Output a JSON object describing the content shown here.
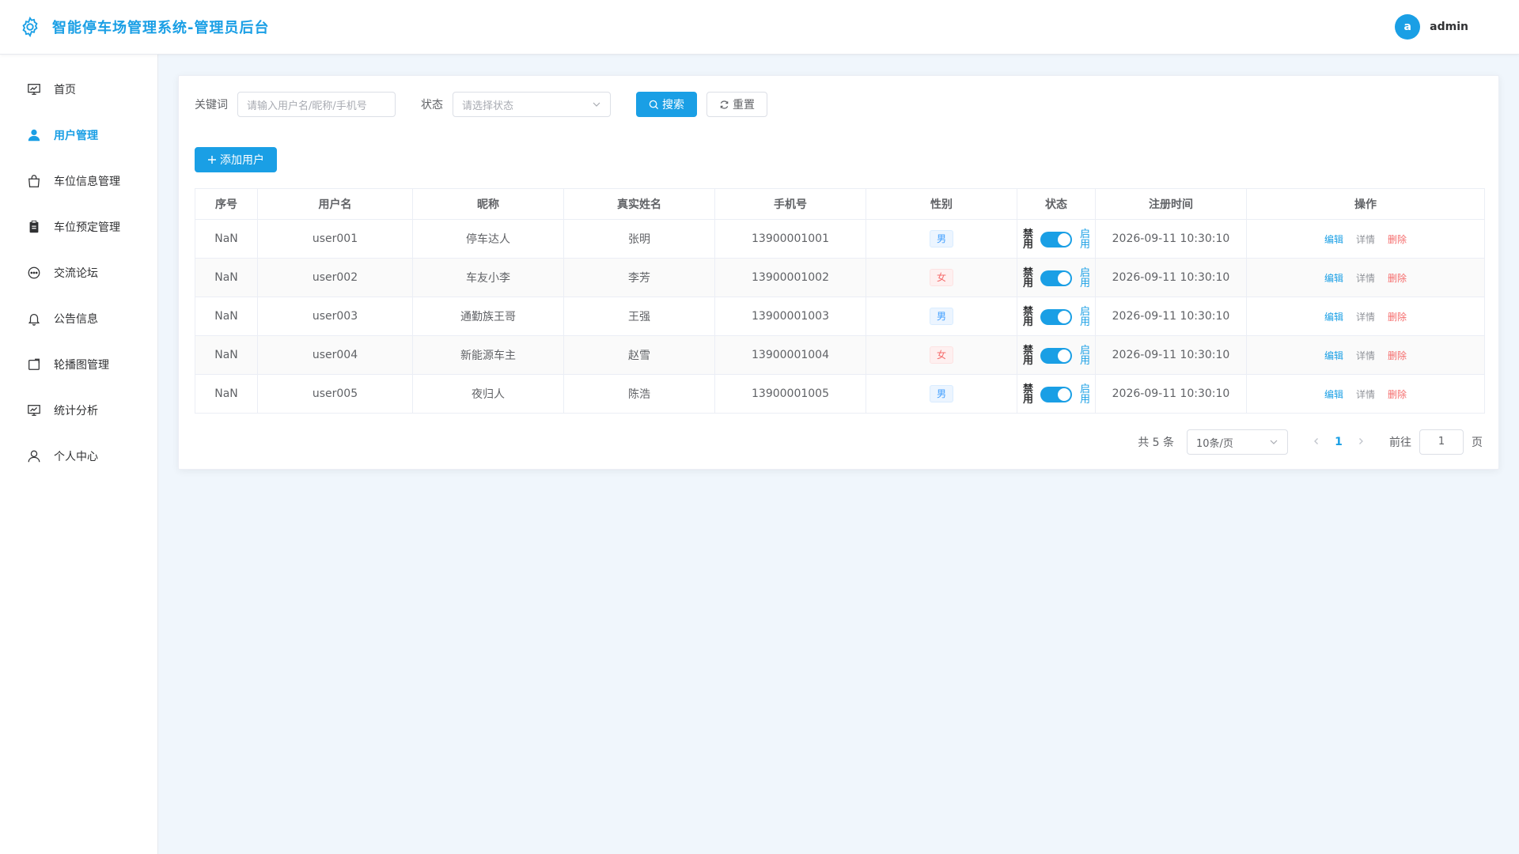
{
  "header": {
    "title": "智能停车场管理系统-管理员后台",
    "avatar_letter": "a",
    "username": "admin"
  },
  "sidebar": {
    "items": [
      {
        "label": "首页",
        "icon": "dashboard-icon"
      },
      {
        "label": "用户管理",
        "icon": "user-icon",
        "active": true
      },
      {
        "label": "车位信息管理",
        "icon": "bag-icon"
      },
      {
        "label": "车位预定管理",
        "icon": "clipboard-icon"
      },
      {
        "label": "交流论坛",
        "icon": "chat-icon"
      },
      {
        "label": "公告信息",
        "icon": "bell-icon"
      },
      {
        "label": "轮播图管理",
        "icon": "image-icon"
      },
      {
        "label": "统计分析",
        "icon": "chart-icon"
      },
      {
        "label": "个人中心",
        "icon": "person-icon"
      }
    ]
  },
  "filters": {
    "keyword_label": "关键词",
    "keyword_placeholder": "请输入用户名/昵称/手机号",
    "status_label": "状态",
    "status_placeholder": "请选择状态",
    "search_label": "搜索",
    "reset_label": "重置"
  },
  "add_button_label": "添加用户",
  "table": {
    "columns": [
      "序号",
      "用户名",
      "昵称",
      "真实姓名",
      "手机号",
      "性别",
      "状态",
      "注册时间",
      "操作"
    ],
    "switch_off_label": "禁用",
    "switch_on_label": "启用",
    "actions": {
      "edit": "编辑",
      "detail": "详情",
      "delete": "删除"
    },
    "rows": [
      {
        "index": "NaN",
        "username": "user001",
        "nickname": "停车达人",
        "realname": "张明",
        "phone": "13900001001",
        "gender": "男",
        "registered": "2026-09-11 10:30:10"
      },
      {
        "index": "NaN",
        "username": "user002",
        "nickname": "车友小李",
        "realname": "李芳",
        "phone": "13900001002",
        "gender": "女",
        "registered": "2026-09-11 10:30:10"
      },
      {
        "index": "NaN",
        "username": "user003",
        "nickname": "通勤族王哥",
        "realname": "王强",
        "phone": "13900001003",
        "gender": "男",
        "registered": "2026-09-11 10:30:10"
      },
      {
        "index": "NaN",
        "username": "user004",
        "nickname": "新能源车主",
        "realname": "赵雪",
        "phone": "13900001004",
        "gender": "女",
        "registered": "2026-09-11 10:30:10"
      },
      {
        "index": "NaN",
        "username": "user005",
        "nickname": "夜归人",
        "realname": "陈浩",
        "phone": "13900001005",
        "gender": "男",
        "registered": "2026-09-11 10:30:10"
      }
    ]
  },
  "pagination": {
    "total_text": "共 5 条",
    "page_size": "10条/页",
    "current_page": "1",
    "goto_label": "前往",
    "goto_value": "1",
    "page_suffix": "页"
  },
  "colors": {
    "primary": "#1a9fe5",
    "danger": "#f56c6c",
    "background": "#f0f6fc"
  }
}
